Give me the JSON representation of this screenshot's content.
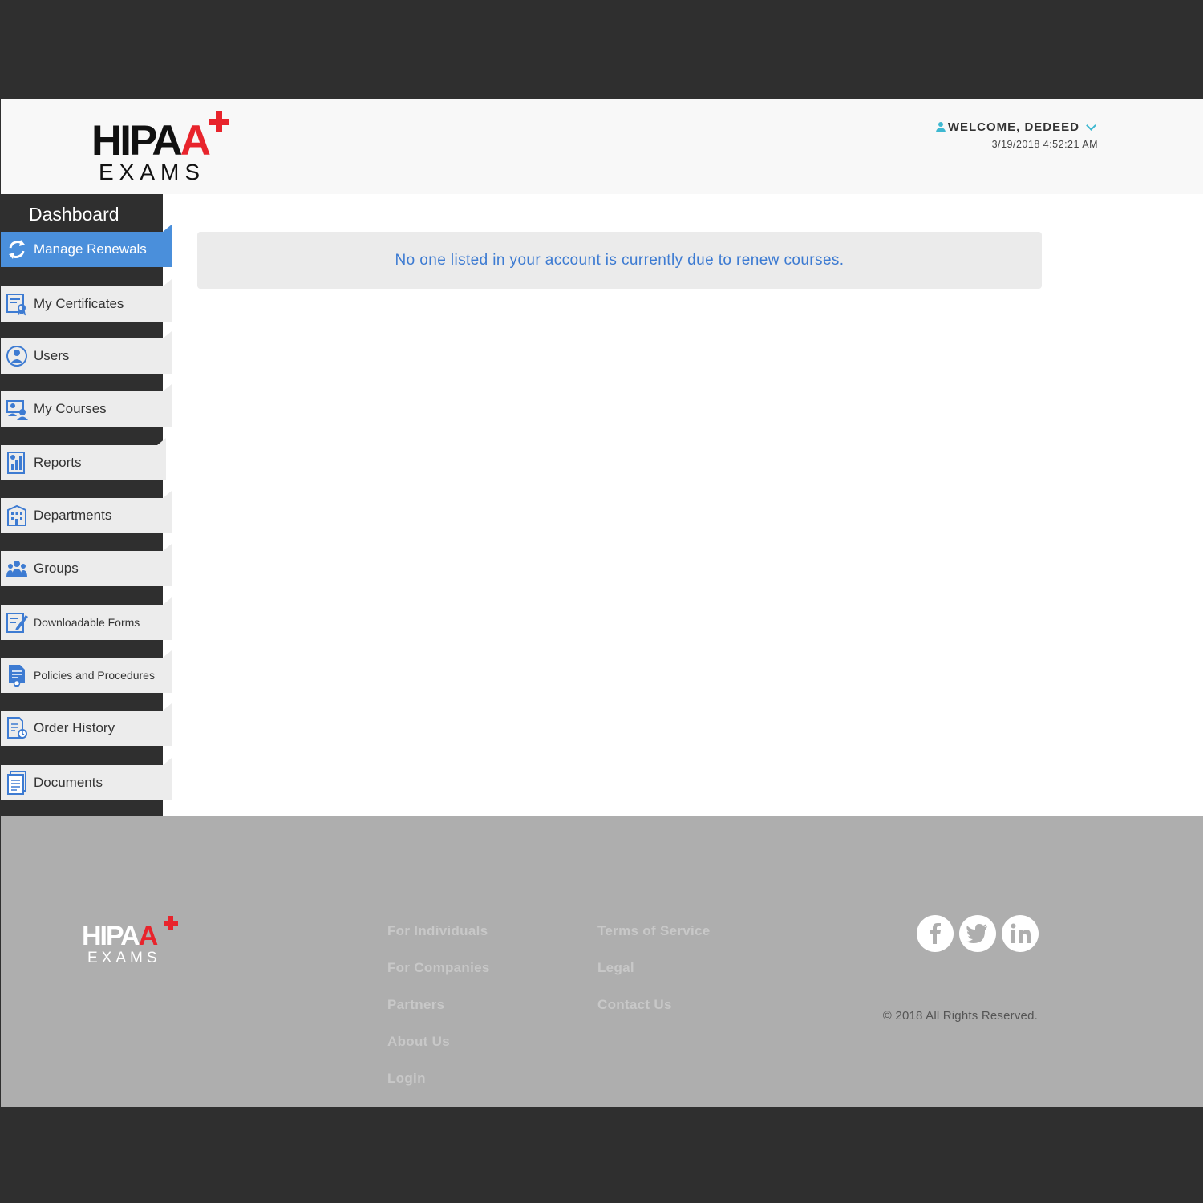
{
  "header": {
    "logo": {
      "word": "HIPA",
      "accent": "A",
      "sub": "EXAMS"
    },
    "welcome": "WELCOME, DEDEED",
    "timestamp": "3/19/2018 4:52:21 AM"
  },
  "sidebar": {
    "title": "Dashboard",
    "items": [
      {
        "label": "Manage Renewals",
        "icon": "refresh-icon",
        "active": true
      },
      {
        "label": "My Certificates",
        "icon": "certificate-icon"
      },
      {
        "label": "Users",
        "icon": "user-icon"
      },
      {
        "label": "My Courses",
        "icon": "courses-icon"
      },
      {
        "label": "Reports",
        "icon": "reports-icon"
      },
      {
        "label": "Departments",
        "icon": "building-icon"
      },
      {
        "label": "Groups",
        "icon": "group-icon"
      },
      {
        "label": "Downloadable Forms",
        "icon": "form-edit-icon"
      },
      {
        "label": "Policies and Procedures",
        "icon": "policy-document-icon"
      },
      {
        "label": "Order History",
        "icon": "order-history-icon"
      },
      {
        "label": "Documents",
        "icon": "documents-icon"
      }
    ]
  },
  "main": {
    "notice": "No one listed in your account is currently due to renew courses."
  },
  "footer": {
    "logo": {
      "word": "HIPA",
      "accent": "A",
      "sub": "EXAMS"
    },
    "col1": [
      "For Individuals",
      "For Companies",
      "Partners",
      "About Us",
      "Login"
    ],
    "col2": [
      "Terms of Service",
      "Legal",
      "Contact Us"
    ],
    "social": [
      "facebook-icon",
      "twitter-icon",
      "linkedin-icon"
    ],
    "copyright": "© 2018 All Rights Reserved."
  },
  "colors": {
    "accent_blue": "#4a8fdb",
    "brand_red": "#e8242c",
    "teal": "#3eb8d1"
  }
}
